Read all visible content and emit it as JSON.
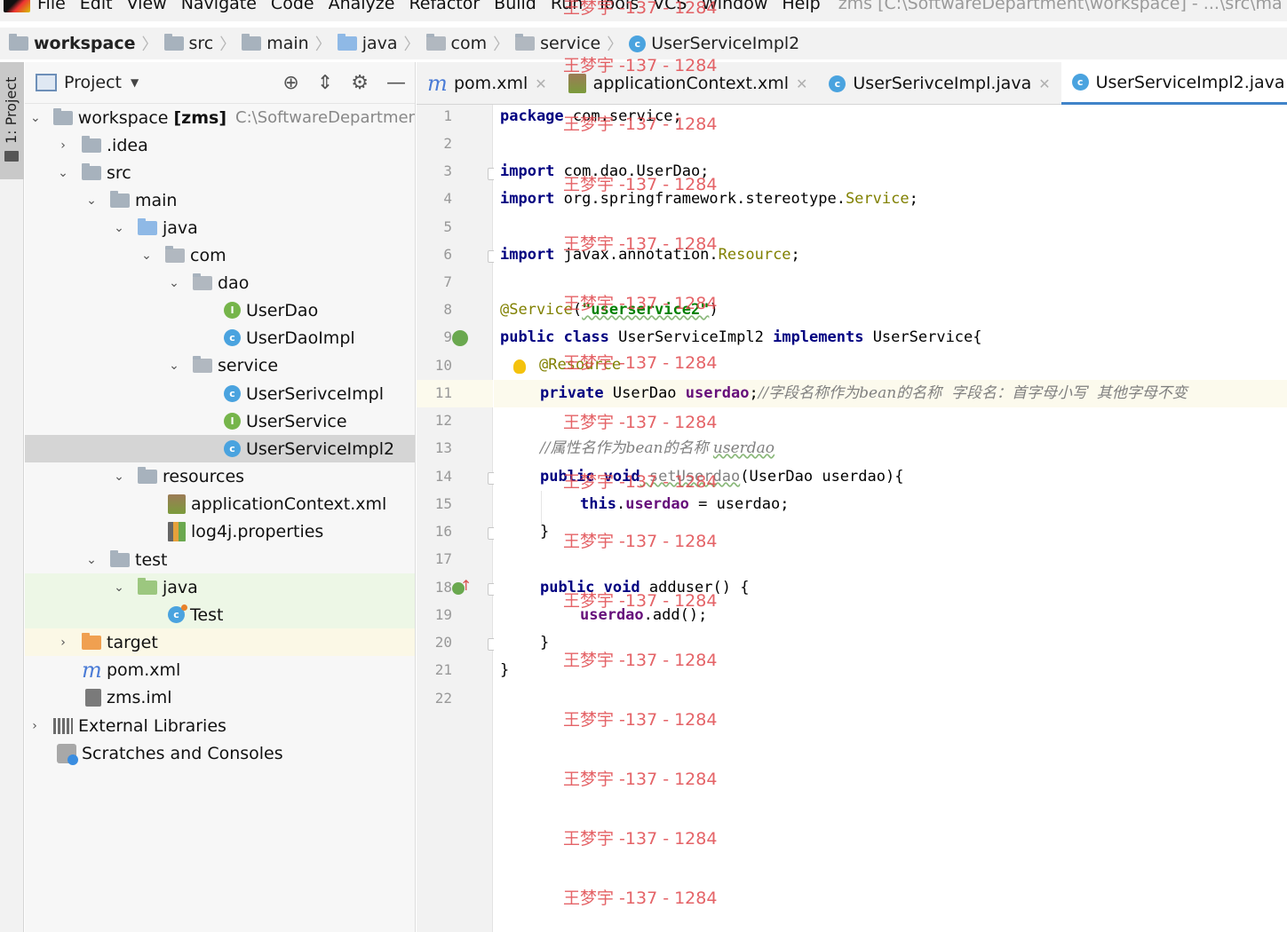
{
  "menu": {
    "items": [
      "File",
      "Edit",
      "View",
      "Navigate",
      "Code",
      "Analyze",
      "Refactor",
      "Build",
      "Run",
      "Tools",
      "VCS",
      "Window",
      "Help"
    ],
    "window_title": "zms [C:\\SoftwareDepartment\\workspace] - ...\\src\\ma"
  },
  "breadcrumb": [
    "workspace",
    "src",
    "main",
    "java",
    "com",
    "service",
    "UserServiceImpl2"
  ],
  "tool_window": {
    "tab_label": "1: Project"
  },
  "project": {
    "title": "Project",
    "tree": [
      {
        "label": "workspace",
        "bold": "[zms]",
        "path": "C:\\SoftwareDepartment"
      },
      {
        "label": ".idea"
      },
      {
        "label": "src"
      },
      {
        "label": "main"
      },
      {
        "label": "java"
      },
      {
        "label": "com"
      },
      {
        "label": "dao"
      },
      {
        "label": "UserDao"
      },
      {
        "label": "UserDaoImpl"
      },
      {
        "label": "service"
      },
      {
        "label": "UserSerivceImpl"
      },
      {
        "label": "UserService"
      },
      {
        "label": "UserServiceImpl2"
      },
      {
        "label": "resources"
      },
      {
        "label": "applicationContext.xml"
      },
      {
        "label": "log4j.properties"
      },
      {
        "label": "test"
      },
      {
        "label": "java"
      },
      {
        "label": "Test"
      },
      {
        "label": "target"
      },
      {
        "label": "pom.xml"
      },
      {
        "label": "zms.iml"
      },
      {
        "label": "External Libraries"
      },
      {
        "label": "Scratches and Consoles"
      }
    ]
  },
  "tabs": [
    {
      "label": "pom.xml",
      "icon": "maven-icon"
    },
    {
      "label": "applicationContext.xml",
      "icon": "xml-icon"
    },
    {
      "label": "UserSerivceImpl.java",
      "icon": "class-icon"
    },
    {
      "label": "UserServiceImpl2.java",
      "icon": "class-icon",
      "active": true
    }
  ],
  "editor": {
    "line_numbers": [
      "1",
      "2",
      "3",
      "4",
      "5",
      "6",
      "7",
      "8",
      "9",
      "10",
      "11",
      "12",
      "13",
      "14",
      "15",
      "16",
      "17",
      "18",
      "19",
      "20",
      "21",
      "22"
    ],
    "current_line": 11,
    "code": {
      "l1_kw": "package",
      "l1_rest": " com.service;",
      "l3_kw": "import",
      "l3_rest": " com.dao.UserDao;",
      "l4_kw": "import",
      "l4_pkg": " org.springframework.stereotype.",
      "l4_cls": "Service",
      "l4_end": ";",
      "l6_kw": "import",
      "l6_pkg": " javax.annotation.",
      "l6_cls": "Resource",
      "l6_end": ";",
      "l8_ann": "@Service",
      "l8_open": "(",
      "l8_str": "\"userservice2\"",
      "l8_close": ")",
      "l9_kw1": "public",
      "l9_kw2": "class",
      "l9_name": " UserServiceImpl2 ",
      "l9_kw3": "implements",
      "l9_rest": " UserService{",
      "l10_ann": "@Resource",
      "l11_kw": "private",
      "l11_type": " UserDao ",
      "l11_field": "userdao",
      "l11_semi": ";",
      "l11_cmt": "//字段名称作为bean的名称  字段名：首字母小写  其他字母不变",
      "l13_cmt": "//属性名作为bean的名称 ",
      "l13_cmt_u": "userdao",
      "l14_kw1": "public",
      "l14_kw2": "void",
      "l14_name": " setUserdao",
      "l14_rest": "(UserDao userdao){",
      "l15_kw": "this",
      "l15_dot": ".",
      "l15_field": "userdao",
      "l15_rest": " = userdao;",
      "l16": "}",
      "l18_kw1": "public",
      "l18_kw2": "void",
      "l18_rest": " adduser() {",
      "l19_field": "userdao",
      "l19_rest": ".add();",
      "l20": "}",
      "l21": "}"
    }
  },
  "watermark": "王梦宇 -137 - 1284",
  "colors": {
    "keyword": "#000080",
    "annotation": "#808000",
    "string": "#008000",
    "field": "#660e7a",
    "comment": "#808080",
    "active_tab_underline": "#4083c9",
    "watermark": "#e0484d"
  }
}
